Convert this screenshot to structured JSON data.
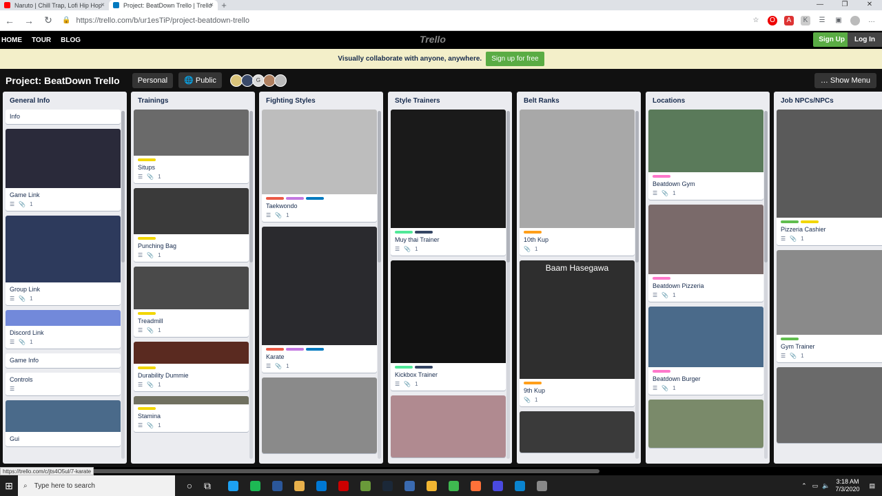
{
  "browser": {
    "tabs": [
      {
        "title": "Naruto | Chill Trap, Lofi Hip Hop",
        "color": "#ff0000"
      },
      {
        "title": "Project: BeatDown Trello | Trello",
        "color": "#0079bf"
      }
    ],
    "url": "https://trello.com/b/ur1esTiP/project-beatdown-trello",
    "status_url": "https://trello.com/c/jts4O5ul/7-karate"
  },
  "trello": {
    "nav": [
      "HOME",
      "TOUR",
      "BLOG"
    ],
    "logo": "Trello",
    "signup": "Sign Up",
    "login": "Log In",
    "banner_text": "Visually collaborate with anyone, anywhere.",
    "banner_button": "Sign up for free"
  },
  "board": {
    "title": "Project: BeatDown Trello",
    "personal": "Personal",
    "visibility": "Public",
    "show_menu": "Show Menu",
    "members": [
      "",
      "",
      "G",
      "",
      ""
    ]
  },
  "lists": [
    {
      "title": "General Info",
      "cards": [
        {
          "title": "Info"
        },
        {
          "title": "Game Link",
          "img": "#2a2a3a",
          "img_h": 86,
          "att": "1"
        },
        {
          "title": "Group Link",
          "img": "#2d3a5c",
          "img_h": 97,
          "att": "1"
        },
        {
          "title": "Discord Link",
          "img": "#7289da",
          "img_h": 23,
          "att": "1"
        },
        {
          "title": "Game Info"
        },
        {
          "title": "Controls",
          "desc_only": true
        },
        {
          "title": "Gui",
          "img": "#4a6a8a",
          "img_h": 46
        }
      ]
    },
    {
      "title": "Trainings",
      "cards": [
        {
          "title": "Situps",
          "img": "#6a6a6a",
          "img_h": 67,
          "labels": [
            "#f2d600"
          ],
          "att": "1"
        },
        {
          "title": "Punching Bag",
          "img": "#3a3a3a",
          "img_h": 67,
          "labels": [
            "#f2d600"
          ],
          "att": "1"
        },
        {
          "title": "Treadmill",
          "img": "#4a4a4a",
          "img_h": 62,
          "labels": [
            "#f2d600"
          ],
          "att": "1"
        },
        {
          "title": "Durability Dummie",
          "img": "#5a2a20",
          "img_h": 32,
          "labels": [
            "#f2d600"
          ],
          "att": "1"
        },
        {
          "title": "Stamina",
          "img": "#707060",
          "img_h": 12,
          "labels": [
            "#f2d600"
          ],
          "att": "1"
        }
      ]
    },
    {
      "title": "Fighting Styles",
      "cards": [
        {
          "title": "Taekwondo",
          "img": "#bdbdbd",
          "img_h": 123,
          "labels": [
            "#eb5a46",
            "#c377e0",
            "#0079bf"
          ],
          "att": "1"
        },
        {
          "title": "Karate",
          "img": "#2a2a2e",
          "img_h": 172,
          "labels": [
            "#eb5a46",
            "#c377e0",
            "#0079bf"
          ],
          "att": "1"
        },
        {
          "title": "",
          "img": "#8a8a8a",
          "img_h": 110
        }
      ]
    },
    {
      "title": "Style Trainers",
      "cards": [
        {
          "title": "Muy thai Trainer",
          "img": "#1a1a1a",
          "img_h": 172,
          "labels": [
            "#51e898",
            "#344563"
          ],
          "att": "1"
        },
        {
          "title": "Kickbox Trainer",
          "img": "#121212",
          "img_h": 149,
          "labels": [
            "#51e898",
            "#344563"
          ],
          "att": "1"
        },
        {
          "title": "",
          "img": "#b08a90",
          "img_h": 90
        }
      ]
    },
    {
      "title": "Belt Ranks",
      "cards": [
        {
          "title": "10th Kup",
          "img": "#a8a8a8",
          "img_h": 172,
          "labels": [
            "#ff9f1a"
          ],
          "att": "1",
          "no_desc": true
        },
        {
          "title": "9th Kup",
          "img": "#2e2e2e",
          "img_h": 172,
          "caption": "Baam Hasegawa",
          "labels": [
            "#ff9f1a"
          ],
          "att": "1",
          "no_desc": true
        },
        {
          "title": "",
          "img": "#3a3a3a",
          "img_h": 60
        }
      ]
    },
    {
      "title": "Locations",
      "cards": [
        {
          "title": "Beatdown Gym",
          "img": "#5a7a5a",
          "img_h": 91,
          "labels": [
            "#ff78cb"
          ],
          "att": "1"
        },
        {
          "title": "Beatdown Pizzeria",
          "img": "#7a6a6a",
          "img_h": 101,
          "labels": [
            "#ff78cb"
          ],
          "att": "1"
        },
        {
          "title": "Beatdown Burger",
          "img": "#4a6a8a",
          "img_h": 88,
          "labels": [
            "#ff78cb"
          ],
          "att": "1"
        },
        {
          "title": "",
          "img": "#7a8a6a",
          "img_h": 70
        }
      ]
    },
    {
      "title": "Job NPCs/NPCs",
      "cards": [
        {
          "title": "Pizzeria Cashier",
          "img": "#5a5a5a",
          "img_h": 157,
          "labels": [
            "#61bd4f",
            "#f2d600"
          ],
          "att": "1"
        },
        {
          "title": "Gym Trainer",
          "img": "#8a8a8a",
          "img_h": 123,
          "labels": [
            "#61bd4f"
          ],
          "att": "1"
        },
        {
          "title": "",
          "img": "#6a6a6a",
          "img_h": 110
        }
      ]
    }
  ],
  "taskbar": {
    "search_placeholder": "Type here to search",
    "time": "3:18 AM",
    "date": "7/3/2020",
    "apps": [
      "#1da1f2",
      "#1db954",
      "#2b579a",
      "#e8b04b",
      "#0078d4",
      "#cc0000",
      "#6a9a3a",
      "#1b2838",
      "#3a6ab0",
      "#f2b632",
      "#3fb950",
      "#ff7139",
      "#4a4ae0",
      "#0a84d0",
      "#888888"
    ]
  }
}
